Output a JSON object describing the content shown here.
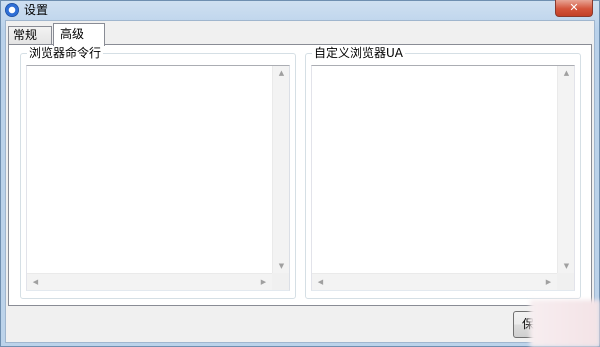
{
  "window": {
    "title": "设置",
    "close_symbol": "✕"
  },
  "tabs": [
    {
      "label": "常规",
      "active": false
    },
    {
      "label": "高级",
      "active": true
    }
  ],
  "groups": {
    "left": {
      "label": "浏览器命令行",
      "value": ""
    },
    "right": {
      "label": "自定义浏览器UA",
      "value": ""
    }
  },
  "scroll_arrows": {
    "up": "▲",
    "down": "▼",
    "left": "◀",
    "right": "▶"
  },
  "footer": {
    "save_label": "保"
  },
  "icons": {
    "app": "app-logo-icon",
    "close": "close-icon"
  }
}
